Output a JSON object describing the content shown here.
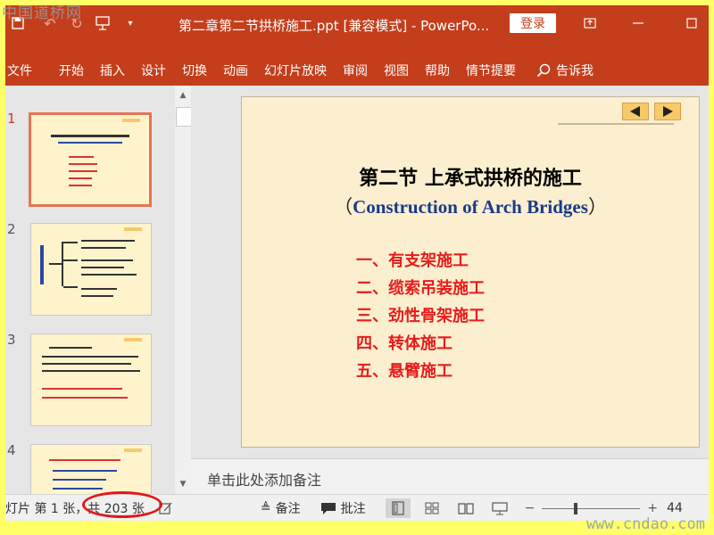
{
  "watermark_top": "中国道桥网",
  "watermark_bottom": "www.cndao.com",
  "title_bar": {
    "document_title": "第二章第二节拱桥施工.ppt [兼容模式]  -  PowerPo...",
    "login_label": "登录"
  },
  "ribbon": {
    "tabs": [
      "文件",
      "开始",
      "插入",
      "设计",
      "切换",
      "动画",
      "幻灯片放映",
      "审阅",
      "视图",
      "帮助",
      "情节提要"
    ],
    "tell_me": "告诉我"
  },
  "thumbnails": {
    "numbers": [
      "1",
      "2",
      "3",
      "4"
    ]
  },
  "slide": {
    "title": "第二节    上承式拱桥的施工",
    "subtitle_open": "（",
    "subtitle_en": "Construction of Arch Bridges",
    "subtitle_close": "）",
    "items": [
      "一、有支架施工",
      "二、缆索吊装施工",
      "三、劲性骨架施工",
      "四、转体施工",
      "五、悬臂施工"
    ]
  },
  "notes_placeholder": "单击此处添加备注",
  "status_bar": {
    "slide_counter": "灯片 第 1 张，共 203 张",
    "notes_label": "备注",
    "comments_label": "批注",
    "zoom_label": "44"
  },
  "colors": {
    "accent": "#c43e1c",
    "slide_background": "#fbefcf",
    "slide_list": "#e81b1b",
    "subtitle_english": "#1a3a8a",
    "annotation_circle": "#e01818"
  }
}
